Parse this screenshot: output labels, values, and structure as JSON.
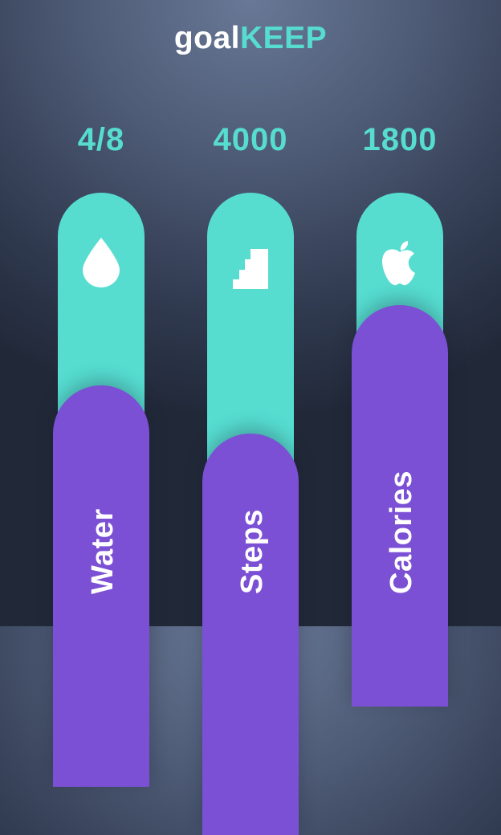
{
  "app": {
    "title_part1": "goal",
    "title_part2": "KEEP"
  },
  "colors": {
    "background_top": "#687896",
    "background_bottom": "#212939",
    "accent_teal": "#56ddd0",
    "accent_purple": "#7b50d4",
    "text_white": "#ffffff"
  },
  "goals": [
    {
      "value": "4/8",
      "label": "Water",
      "icon": "water-drop-icon",
      "progress": 0.5
    },
    {
      "value": "4000",
      "label": "Steps",
      "icon": "stairs-icon",
      "progress": 0.4
    },
    {
      "value": "1800",
      "label": "Calories",
      "icon": "apple-icon",
      "progress": 0.72
    }
  ]
}
